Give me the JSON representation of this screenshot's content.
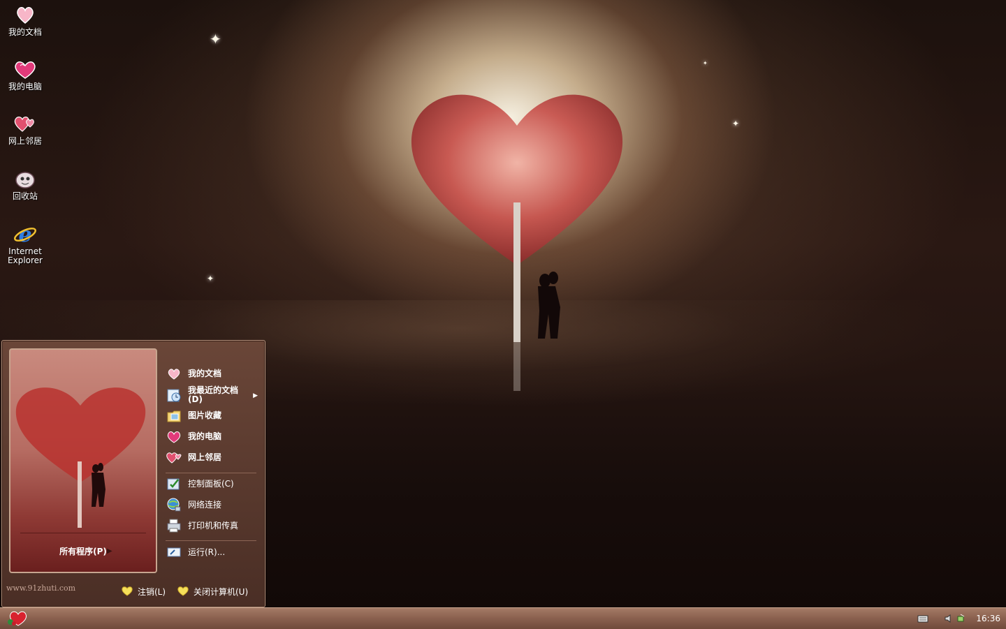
{
  "desktop": {
    "icons": [
      {
        "label": "我的文档",
        "icon": "my-documents-heart-icon"
      },
      {
        "label": "我的电脑",
        "icon": "my-computer-heart-icon"
      },
      {
        "label": "网上邻居",
        "icon": "network-places-heart-icon"
      },
      {
        "label": "回收站",
        "icon": "recycle-bin-icon"
      },
      {
        "label": "Internet\nExplorer",
        "label_line1": "Internet",
        "label_line2": "Explorer",
        "icon": "internet-explorer-icon"
      }
    ]
  },
  "start_menu": {
    "all_programs": "所有程序(P)",
    "items_top": [
      {
        "label": "我的文档",
        "icon": "my-documents-icon"
      },
      {
        "label": "我最近的文档",
        "label_line2": "(D)",
        "icon": "recent-documents-icon",
        "has_submenu": true
      },
      {
        "label": "图片收藏",
        "icon": "my-pictures-icon"
      },
      {
        "label": "我的电脑",
        "icon": "my-computer-icon"
      },
      {
        "label": "网上邻居",
        "icon": "network-places-icon"
      }
    ],
    "items_middle": [
      {
        "label": "控制面板(C)",
        "icon": "control-panel-icon"
      },
      {
        "label": "网络连接",
        "icon": "network-connections-icon"
      },
      {
        "label": "打印机和传真",
        "icon": "printers-icon"
      }
    ],
    "items_bottom": [
      {
        "label": "运行(R)...",
        "icon": "run-icon"
      }
    ],
    "watermark": "www.91zhuti.com",
    "logoff_label": "注销(L)",
    "shutdown_label": "关闭计算机(U)"
  },
  "taskbar": {
    "clock": "16:36",
    "tray_icons": [
      "keyboard-icon",
      "speaker-icon",
      "network-tray-icon"
    ]
  },
  "colors": {
    "taskbar": "#8c6250",
    "start_menu": "#5a392d",
    "accent_heart": "#e0304a"
  }
}
